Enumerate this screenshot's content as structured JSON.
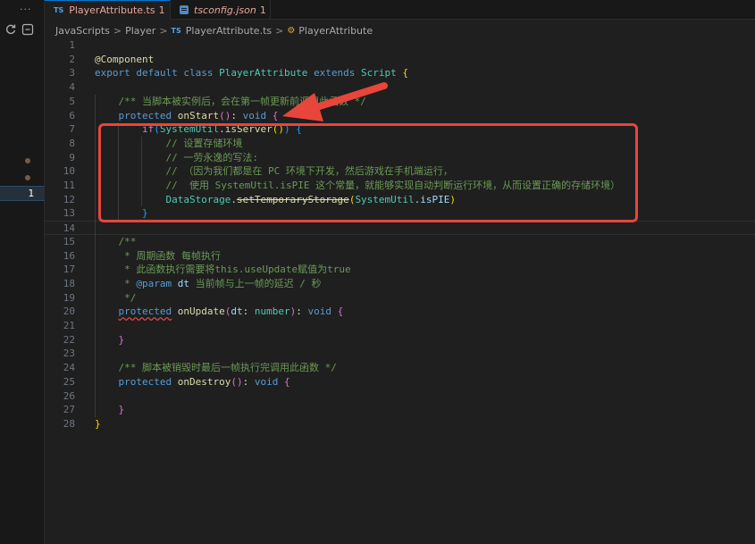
{
  "window": {
    "more_label": "···"
  },
  "tabs": [
    {
      "badge": "TS",
      "title": "PlayerAttribute.ts",
      "count": "1",
      "modified": true,
      "active": true
    },
    {
      "badge": "",
      "title": "tsconfig.json",
      "count": "1",
      "modified": false,
      "active": false
    }
  ],
  "breadcrumb": {
    "items": [
      "JavaScripts",
      "Player",
      "PlayerAttribute.ts",
      "PlayerAttribute"
    ],
    "ts_badge": "TS",
    "separator": ">"
  },
  "activity": {
    "current_line_number": "1"
  },
  "editor": {
    "lines": [
      {
        "n": "1",
        "tokens": []
      },
      {
        "n": "2",
        "tokens": [
          {
            "t": "@Component",
            "c": "dec"
          }
        ]
      },
      {
        "n": "3",
        "tokens": [
          {
            "t": "export ",
            "c": "kw"
          },
          {
            "t": "default ",
            "c": "kw"
          },
          {
            "t": "class ",
            "c": "kw"
          },
          {
            "t": "PlayerAttribute ",
            "c": "type"
          },
          {
            "t": "extends ",
            "c": "kw"
          },
          {
            "t": "Script ",
            "c": "type"
          },
          {
            "t": "{",
            "c": "br1"
          }
        ]
      },
      {
        "n": "4",
        "tokens": []
      },
      {
        "n": "5",
        "tokens": [
          {
            "t": "    /** 当脚本被实例后，会在第一帧更新前调用此函数 */",
            "c": "com"
          }
        ]
      },
      {
        "n": "6",
        "tokens": [
          {
            "t": "    ",
            "c": "plain"
          },
          {
            "t": "protected ",
            "c": "kw"
          },
          {
            "t": "onStart",
            "c": "fn"
          },
          {
            "t": "()",
            "c": "br2"
          },
          {
            "t": ": ",
            "c": "plain"
          },
          {
            "t": "void ",
            "c": "kw"
          },
          {
            "t": "{",
            "c": "br2"
          }
        ]
      },
      {
        "n": "7",
        "tokens": [
          {
            "t": "        ",
            "c": "plain"
          },
          {
            "t": "if",
            "c": "ctrl"
          },
          {
            "t": "(",
            "c": "br3"
          },
          {
            "t": "SystemUtil",
            "c": "type"
          },
          {
            "t": ".",
            "c": "plain"
          },
          {
            "t": "isServer",
            "c": "fn"
          },
          {
            "t": "()",
            "c": "br1"
          },
          {
            "t": ") ",
            "c": "br3"
          },
          {
            "t": "{",
            "c": "br3"
          }
        ]
      },
      {
        "n": "8",
        "tokens": [
          {
            "t": "            // 设置存储环境",
            "c": "com"
          }
        ]
      },
      {
        "n": "9",
        "tokens": [
          {
            "t": "            // 一劳永逸的写法:",
            "c": "com"
          }
        ]
      },
      {
        "n": "10",
        "tokens": [
          {
            "t": "            // （因为我们都是在 PC 环境下开发，然后游戏在手机端运行，",
            "c": "com"
          }
        ]
      },
      {
        "n": "11",
        "tokens": [
          {
            "t": "            //  使用 SystemUtil.isPIE 这个常量，就能够实现自动判断运行环境，从而设置正确的存储环境）",
            "c": "com"
          }
        ]
      },
      {
        "n": "12",
        "tokens": [
          {
            "t": "            ",
            "c": "plain"
          },
          {
            "t": "DataStorage",
            "c": "type"
          },
          {
            "t": ".",
            "c": "plain"
          },
          {
            "t": "setTemporaryStorage",
            "c": "strike"
          },
          {
            "t": "(",
            "c": "br1"
          },
          {
            "t": "SystemUtil",
            "c": "type"
          },
          {
            "t": ".",
            "c": "plain"
          },
          {
            "t": "isPIE",
            "c": "var"
          },
          {
            "t": ")",
            "c": "br1"
          }
        ]
      },
      {
        "n": "13",
        "tokens": [
          {
            "t": "        ",
            "c": "plain"
          },
          {
            "t": "}",
            "c": "br3"
          }
        ]
      },
      {
        "n": "14",
        "tokens": [],
        "current": true
      },
      {
        "n": "15",
        "tokens": [
          {
            "t": "    /**",
            "c": "com"
          }
        ]
      },
      {
        "n": "16",
        "tokens": [
          {
            "t": "     * 周期函数 每帧执行",
            "c": "com"
          }
        ]
      },
      {
        "n": "17",
        "tokens": [
          {
            "t": "     * 此函数执行需要将this.useUpdate赋值为true",
            "c": "com"
          }
        ]
      },
      {
        "n": "18",
        "tokens": [
          {
            "t": "     * ",
            "c": "com"
          },
          {
            "t": "@param ",
            "c": "docparam"
          },
          {
            "t": "dt ",
            "c": "docname"
          },
          {
            "t": "当前帧与上一帧的延迟 / 秒",
            "c": "com"
          }
        ]
      },
      {
        "n": "19",
        "tokens": [
          {
            "t": "     */",
            "c": "com"
          }
        ]
      },
      {
        "n": "20",
        "tokens": [
          {
            "t": "    ",
            "c": "plain"
          },
          {
            "t": "protected",
            "c": "kw-squig"
          },
          {
            "t": " ",
            "c": "plain"
          },
          {
            "t": "onUpdate",
            "c": "fn"
          },
          {
            "t": "(",
            "c": "br2"
          },
          {
            "t": "dt",
            "c": "var"
          },
          {
            "t": ": ",
            "c": "plain"
          },
          {
            "t": "number",
            "c": "type"
          },
          {
            "t": ")",
            "c": "br2"
          },
          {
            "t": ": ",
            "c": "plain"
          },
          {
            "t": "void ",
            "c": "kw"
          },
          {
            "t": "{",
            "c": "br2"
          }
        ]
      },
      {
        "n": "21",
        "tokens": []
      },
      {
        "n": "22",
        "tokens": [
          {
            "t": "    ",
            "c": "plain"
          },
          {
            "t": "}",
            "c": "br2"
          }
        ]
      },
      {
        "n": "23",
        "tokens": []
      },
      {
        "n": "24",
        "tokens": [
          {
            "t": "    /** 脚本被销毁时最后一帧执行完调用此函数 */",
            "c": "com"
          }
        ]
      },
      {
        "n": "25",
        "tokens": [
          {
            "t": "    ",
            "c": "plain"
          },
          {
            "t": "protected ",
            "c": "kw"
          },
          {
            "t": "onDestroy",
            "c": "fn"
          },
          {
            "t": "()",
            "c": "br2"
          },
          {
            "t": ": ",
            "c": "plain"
          },
          {
            "t": "void ",
            "c": "kw"
          },
          {
            "t": "{",
            "c": "br2"
          }
        ]
      },
      {
        "n": "26",
        "tokens": []
      },
      {
        "n": "27",
        "tokens": [
          {
            "t": "    ",
            "c": "plain"
          },
          {
            "t": "}",
            "c": "br2"
          }
        ]
      },
      {
        "n": "28",
        "tokens": [
          {
            "t": "}",
            "c": "br1"
          }
        ]
      }
    ]
  },
  "colors": {
    "accent": "#0078d4",
    "annotation": "#e8453c"
  }
}
